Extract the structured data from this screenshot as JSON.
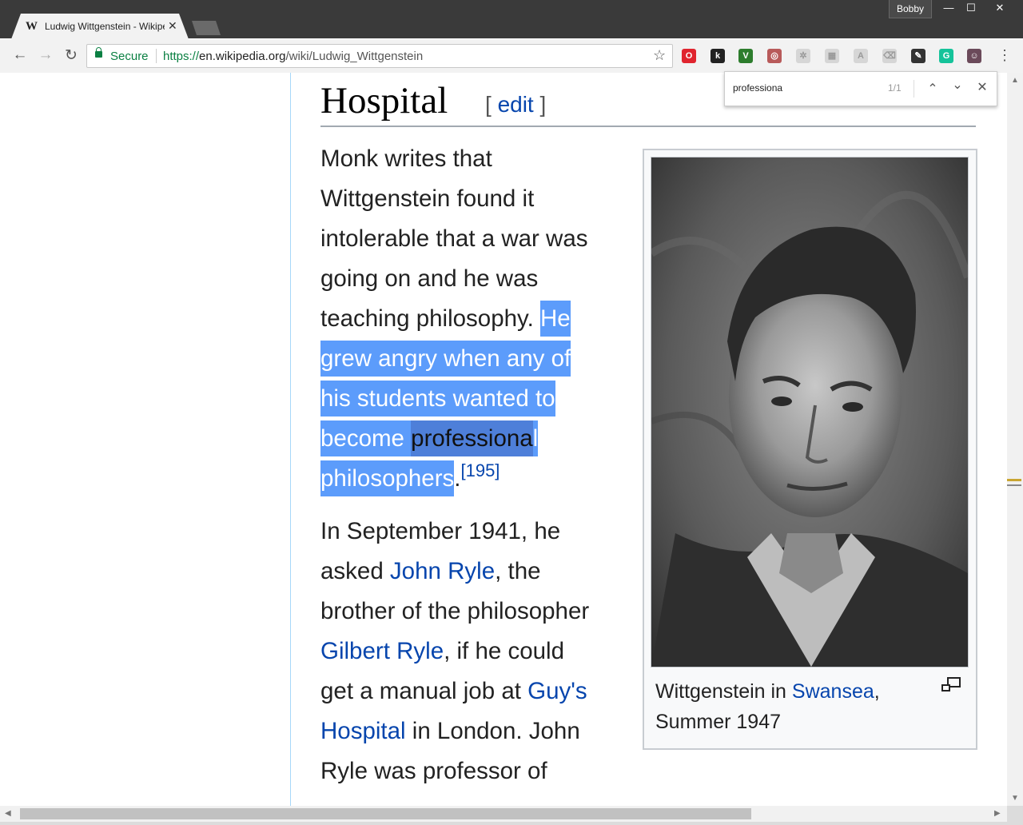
{
  "window": {
    "profile_name": "Bobby",
    "minimize_glyph": "—",
    "maximize_glyph": "☐",
    "close_glyph": "✕"
  },
  "tab": {
    "favicon": "W",
    "title": "Ludwig Wittgenstein - Wikipedia",
    "close_glyph": "✕"
  },
  "toolbar": {
    "back_glyph": "←",
    "forward_glyph": "→",
    "reload_glyph": "↻",
    "secure_label": "Secure",
    "url_scheme": "https://",
    "url_host": "en.wikipedia.org",
    "url_path": "/wiki/Ludwig_Wittgenstein",
    "star_glyph": "☆",
    "menu_glyph": "⋮",
    "extensions": [
      {
        "name": "opera-icon",
        "label": "O",
        "color": "#e0242e"
      },
      {
        "name": "k-extension-icon",
        "label": "k",
        "color": "#222222"
      },
      {
        "name": "v-extension-icon",
        "label": "V",
        "color": "#2d7d2d"
      },
      {
        "name": "glasses-extension-icon",
        "label": "◎",
        "color": "#b85a5a"
      },
      {
        "name": "gear-extension-icon",
        "label": "✲",
        "color": "#d6d6d6"
      },
      {
        "name": "grid-extension-icon",
        "label": "▦",
        "color": "#d6d6d6"
      },
      {
        "name": "angular-extension-icon",
        "label": "A",
        "color": "#d6d6d6"
      },
      {
        "name": "eraser-extension-icon",
        "label": "⌫",
        "color": "#d6d6d6"
      },
      {
        "name": "puzzle-extension-icon",
        "label": "✎",
        "color": "#333333"
      },
      {
        "name": "grammarly-icon",
        "label": "G",
        "color": "#15c39a"
      },
      {
        "name": "avatar-extension-icon",
        "label": "☺",
        "color": "#6b4a5a"
      }
    ]
  },
  "find": {
    "query": "professiona",
    "count": "1/1",
    "prev_glyph": "⌃",
    "next_glyph": "⌄",
    "close_glyph": "✕"
  },
  "article": {
    "heading": "Hospital",
    "edit_open": "[ ",
    "edit_label": "edit",
    "edit_close": " ]",
    "p1": {
      "l1": "Monk writes that",
      "l2": "Wittgenstein found it",
      "l3": "intolerable that a war was",
      "l4": "going on and he was",
      "l5_plain": "teaching philosophy. ",
      "l5_sel": "He",
      "l6": "grew angry when any of",
      "l7": "his students wanted to",
      "l8_pre": "become ",
      "l8_match": "professiona",
      "l8_post": "l",
      "l9_sel": "philosophers",
      "l9_end": ".",
      "ref": "[195]"
    },
    "p2": {
      "l1": "In September 1941, he",
      "l2_pre": "asked ",
      "l2_link": "John Ryle",
      "l2_post": ", the",
      "l3": "brother of the philosopher",
      "l4_link": "Gilbert Ryle",
      "l4_post": ", if he could",
      "l5_pre": "get a manual job at ",
      "l5_link": "Guy's",
      "l6_link": "Hospital",
      "l6_post": " in London. John",
      "l7": "Ryle was professor of"
    },
    "caption_pre": "Wittgenstein in ",
    "caption_link": "Swansea",
    "caption_post": ",",
    "caption_line2": "Summer 1947"
  }
}
